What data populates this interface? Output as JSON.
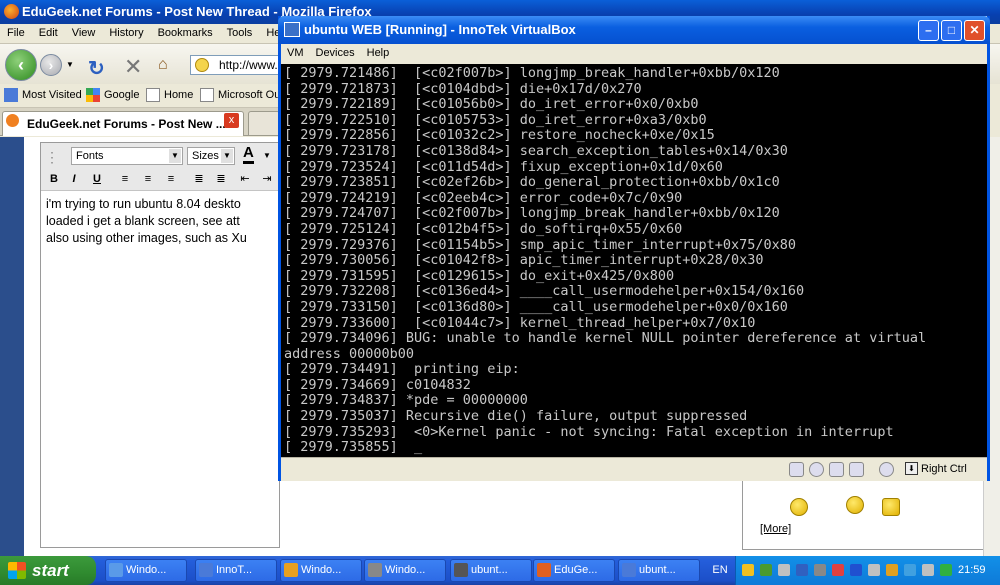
{
  "firefox": {
    "title": "EduGeek.net Forums - Post New Thread - Mozilla Firefox",
    "menu": [
      "File",
      "Edit",
      "View",
      "History",
      "Bookmarks",
      "Tools",
      "He"
    ],
    "url": "http://www.",
    "bookmarks": [
      "Most Visited",
      "Google",
      "Home",
      "Microsoft Ou"
    ],
    "tab_active": "EduGeek.net Forums - Post New ...",
    "tab_close": "x",
    "editor": {
      "font_select": "Fonts",
      "size_select": "Sizes",
      "bold": "B",
      "italic": "I",
      "underline": "U",
      "text_lines": [
        "i'm trying to run ubuntu 8.04 deskto",
        "loaded i get a blank screen, see att",
        "also using other images, such as Xu"
      ]
    },
    "more_link": "[More]"
  },
  "virtualbox": {
    "title": "ubuntu WEB [Running] - InnoTek VirtualBox",
    "menu": [
      "VM",
      "Devices",
      "Help"
    ],
    "console_lines": [
      "[ 2979.721486]  [<c02f007b>] longjmp_break_handler+0xbb/0x120",
      "[ 2979.721873]  [<c0104dbd>] die+0x17d/0x270",
      "[ 2979.722189]  [<c01056b0>] do_iret_error+0x0/0xb0",
      "[ 2979.722510]  [<c0105753>] do_iret_error+0xa3/0xb0",
      "[ 2979.722856]  [<c01032c2>] restore_nocheck+0xe/0x15",
      "[ 2979.723178]  [<c0138d84>] search_exception_tables+0x14/0x30",
      "[ 2979.723524]  [<c011d54d>] fixup_exception+0x1d/0x60",
      "[ 2979.723851]  [<c02ef26b>] do_general_protection+0xbb/0x1c0",
      "[ 2979.724219]  [<c02eeb4c>] error_code+0x7c/0x90",
      "[ 2979.724707]  [<c02f007b>] longjmp_break_handler+0xbb/0x120",
      "[ 2979.725124]  [<c012b4f5>] do_softirq+0x55/0x60",
      "[ 2979.729376]  [<c01154b5>] smp_apic_timer_interrupt+0x75/0x80",
      "[ 2979.730056]  [<c01042f8>] apic_timer_interrupt+0x28/0x30",
      "[ 2979.731595]  [<c0129615>] do_exit+0x425/0x800",
      "[ 2979.732208]  [<c0136ed4>] ____call_usermodehelper+0x154/0x160",
      "[ 2979.733150]  [<c0136d80>] ____call_usermodehelper+0x0/0x160",
      "[ 2979.733600]  [<c01044c7>] kernel_thread_helper+0x7/0x10",
      "[ 2979.734096] BUG: unable to handle kernel NULL pointer dereference at virtual",
      "address 00000b00",
      "[ 2979.734491]  printing eip:",
      "[ 2979.734669] c0104832",
      "[ 2979.734837] *pde = 00000000",
      "[ 2979.735037] Recursive die() failure, output suppressed",
      "[ 2979.735293]  <0>Kernel panic - not syncing: Fatal exception in interrupt",
      "[ 2979.735855]  _"
    ],
    "host_key": "Right Ctrl"
  },
  "taskbar": {
    "start": "start",
    "buttons": [
      "Windo...",
      "InnoT...",
      "Windo...",
      "Windo...",
      "ubunt...",
      "EduGe...",
      "ubunt..."
    ],
    "button_colors": [
      "#5a9ae8",
      "#4a7ad8",
      "#e8a020",
      "#888888",
      "#555555",
      "#e06020",
      "#4a7ad8"
    ],
    "lang": "EN",
    "clock": "21:59"
  }
}
